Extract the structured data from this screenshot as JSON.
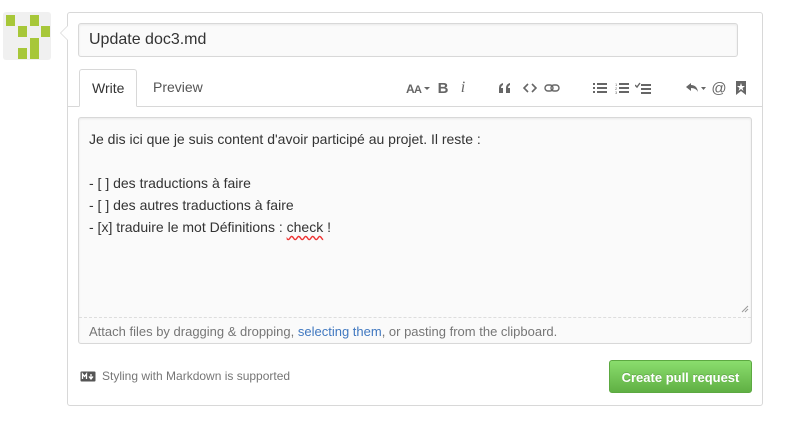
{
  "title_input": {
    "value": "Update doc3.md"
  },
  "tabs": [
    {
      "label": "Write",
      "active": true
    },
    {
      "label": "Preview",
      "active": false
    }
  ],
  "toolbar": {
    "icons": [
      "text-size-icon",
      "bold-icon",
      "italic-icon",
      "quote-icon",
      "code-icon",
      "link-icon",
      "unordered-list-icon",
      "ordered-list-icon",
      "task-list-icon",
      "reply-icon",
      "mention-icon",
      "saved-reply-icon"
    ],
    "bold_glyph": "B",
    "italic_glyph": "i",
    "mention_glyph": "@"
  },
  "editor": {
    "lines": [
      "Je dis ici que je suis content d'avoir participé au projet. Il reste :",
      "",
      "- [ ] des traductions à faire",
      "- [ ] des autres traductions à faire"
    ],
    "last_line": {
      "before": "- [x] traduire le mot Définitions : ",
      "misspelled": "check",
      "after": " !"
    }
  },
  "attach": {
    "before": "Attach files by dragging & dropping, ",
    "link": "selecting them",
    "after": ", or pasting from the clipboard."
  },
  "markdown_note": "Styling with Markdown is supported",
  "create_button": "Create pull request",
  "colors": {
    "avatar_green": "#a7c739",
    "button_green": "#6cc644",
    "link_blue": "#4078c0",
    "border": "#d8d8d8"
  }
}
